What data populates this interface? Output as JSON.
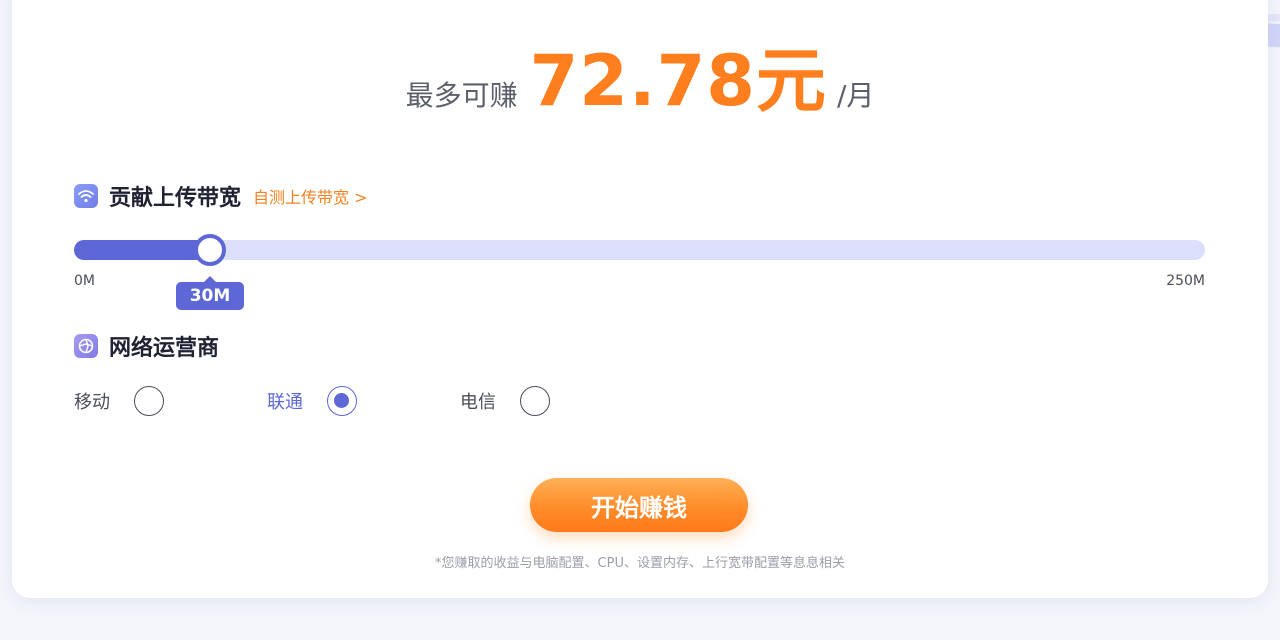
{
  "earnings": {
    "prefix": "最多可赚",
    "amount": "72.78元",
    "suffix": "/月"
  },
  "bandwidth": {
    "title": "贡献上传带宽",
    "test_link": "自测上传带宽 >",
    "slider": {
      "min_label": "0M",
      "max_label": "250M",
      "value_label": "30M",
      "value_mbps": 30,
      "max_mbps": 250
    }
  },
  "isp": {
    "title": "网络运营商",
    "options": [
      {
        "label": "移动",
        "selected": false
      },
      {
        "label": "联通",
        "selected": true
      },
      {
        "label": "电信",
        "selected": false
      }
    ]
  },
  "cta": {
    "label": "开始赚钱"
  },
  "disclaimer": "*您赚取的收益与电脑配置、CPU、设置内存、上行宽带配置等息息相关",
  "colors": {
    "accent": "#5d68d6",
    "track": "#dcdffc",
    "orange": "#ff7f1e"
  },
  "icons": {
    "bandwidth": "wifi-icon",
    "isp": "network-icon"
  }
}
